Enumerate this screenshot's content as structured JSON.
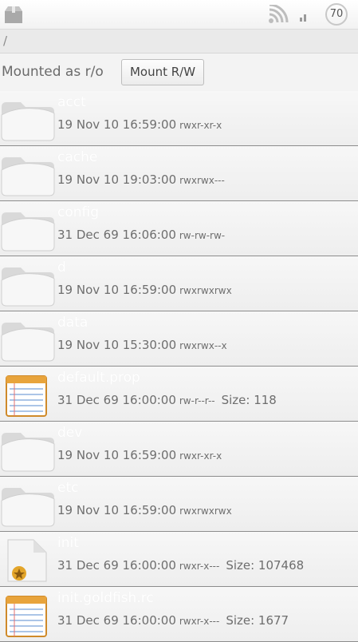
{
  "status": {
    "battery": "70"
  },
  "path": "/",
  "mount": {
    "label": "Mounted as r/o",
    "button": "Mount R/W"
  },
  "files": [
    {
      "name": "acct",
      "date": "19 Nov 10 16:59:00",
      "perm": "rwxr-xr-x",
      "size": "",
      "icon": "folder-icon"
    },
    {
      "name": "cache",
      "date": "19 Nov 10 19:03:00",
      "perm": "rwxrwx---",
      "size": "",
      "icon": "folder-icon"
    },
    {
      "name": "config",
      "date": "31 Dec 69 16:06:00",
      "perm": "rw-rw-rw-",
      "size": "",
      "icon": "folder-icon"
    },
    {
      "name": "d",
      "date": "19 Nov 10 16:59:00",
      "perm": "rwxrwxrwx",
      "size": "",
      "icon": "folder-icon"
    },
    {
      "name": "data",
      "date": "19 Nov 10 15:30:00",
      "perm": "rwxrwx--x",
      "size": "",
      "icon": "folder-icon"
    },
    {
      "name": "default.prop",
      "date": "31 Dec 69 16:00:00",
      "perm": "rw-r--r--",
      "size": "Size: 118",
      "icon": "text-file-icon"
    },
    {
      "name": "dev",
      "date": "19 Nov 10 16:59:00",
      "perm": "rwxr-xr-x",
      "size": "",
      "icon": "folder-icon"
    },
    {
      "name": "etc",
      "date": "19 Nov 10 16:59:00",
      "perm": "rwxrwxrwx",
      "size": "",
      "icon": "folder-icon"
    },
    {
      "name": "init",
      "date": "31 Dec 69 16:00:00",
      "perm": "rwxr-x---",
      "size": "Size: 107468",
      "icon": "executable-file-icon"
    },
    {
      "name": "init.goldfish.rc",
      "date": "31 Dec 69 16:00:00",
      "perm": "rwxr-x---",
      "size": "Size: 1677",
      "icon": "text-file-icon"
    }
  ]
}
